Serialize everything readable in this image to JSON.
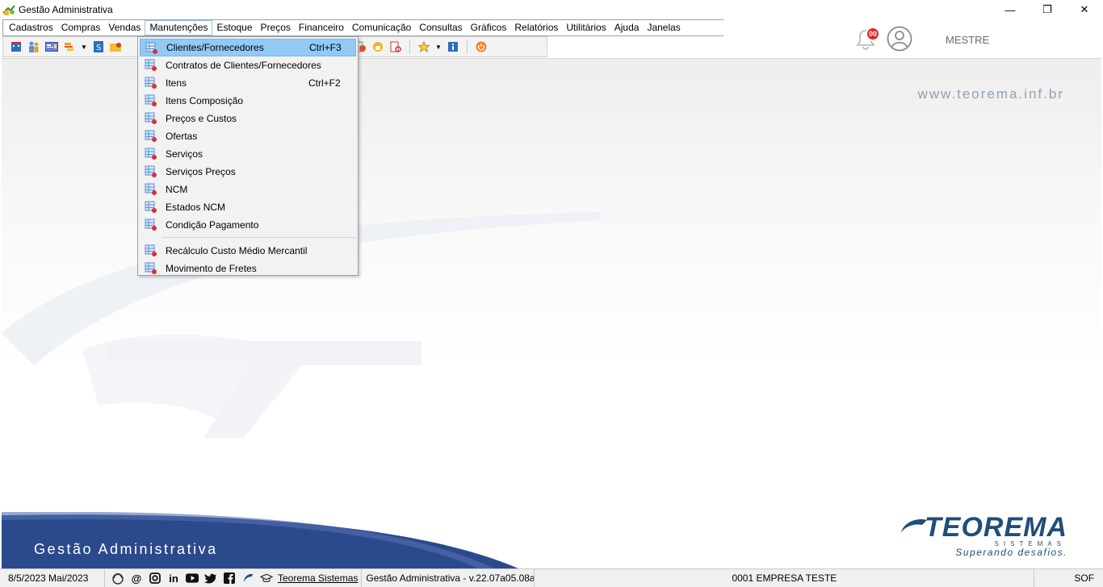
{
  "window": {
    "title": "Gestão Administrativa",
    "minimize_glyph": "—",
    "restore_glyph": "❐",
    "close_glyph": "✕"
  },
  "menu": {
    "items": [
      {
        "label": "Cadastros"
      },
      {
        "label": "Compras"
      },
      {
        "label": "Vendas"
      },
      {
        "label": "Manutenções",
        "active": true
      },
      {
        "label": "Estoque"
      },
      {
        "label": "Preços"
      },
      {
        "label": "Financeiro"
      },
      {
        "label": "Comunicação"
      },
      {
        "label": "Consultas"
      },
      {
        "label": "Gráficos"
      },
      {
        "label": "Relatórios"
      },
      {
        "label": "Utilitários"
      },
      {
        "label": "Ajuda"
      },
      {
        "label": "Janelas"
      }
    ]
  },
  "dropdown": {
    "items": [
      {
        "label": "Clientes/Fornecedores",
        "shortcut": "Ctrl+F3",
        "selected": true
      },
      {
        "label": "Contratos de Clientes/Fornecedores",
        "shortcut": ""
      },
      {
        "label": "Itens",
        "shortcut": "Ctrl+F2"
      },
      {
        "label": "Itens Composição",
        "shortcut": ""
      },
      {
        "label": "Preços e Custos",
        "shortcut": ""
      },
      {
        "label": "Ofertas",
        "shortcut": ""
      },
      {
        "label": "Serviços",
        "shortcut": ""
      },
      {
        "label": "Serviços Preços",
        "shortcut": ""
      },
      {
        "label": "NCM",
        "shortcut": ""
      },
      {
        "label": "Estados NCM",
        "shortcut": ""
      },
      {
        "label": "Condição Pagamento",
        "shortcut": ""
      },
      {
        "label": "Recálculo Custo Médio Mercantil",
        "shortcut": ""
      },
      {
        "label": "Movimento de Fretes",
        "shortcut": ""
      }
    ]
  },
  "header_right": {
    "notification_count": "00",
    "user_name": "MESTRE"
  },
  "workspace": {
    "website": "www.teorema.inf.br",
    "banner_text": "Gestão Administrativa",
    "logo_name": "TEOREMA",
    "logo_sub": "SISTEMAS",
    "logo_slogan": "Superando desafios."
  },
  "status": {
    "date": "8/5/2023 Mai/2023",
    "company_link": "Teorema Sistemas",
    "version": "Gestão Administrativa - v.22.07a05.08a",
    "company": "0001 EMPRESA TESTE",
    "right_cell": "SOF"
  },
  "colors": {
    "selection": "#91c9f7",
    "brand_blue": "#1f4e79",
    "banner_blue": "#2b4a8c",
    "badge_red": "#e52222"
  }
}
